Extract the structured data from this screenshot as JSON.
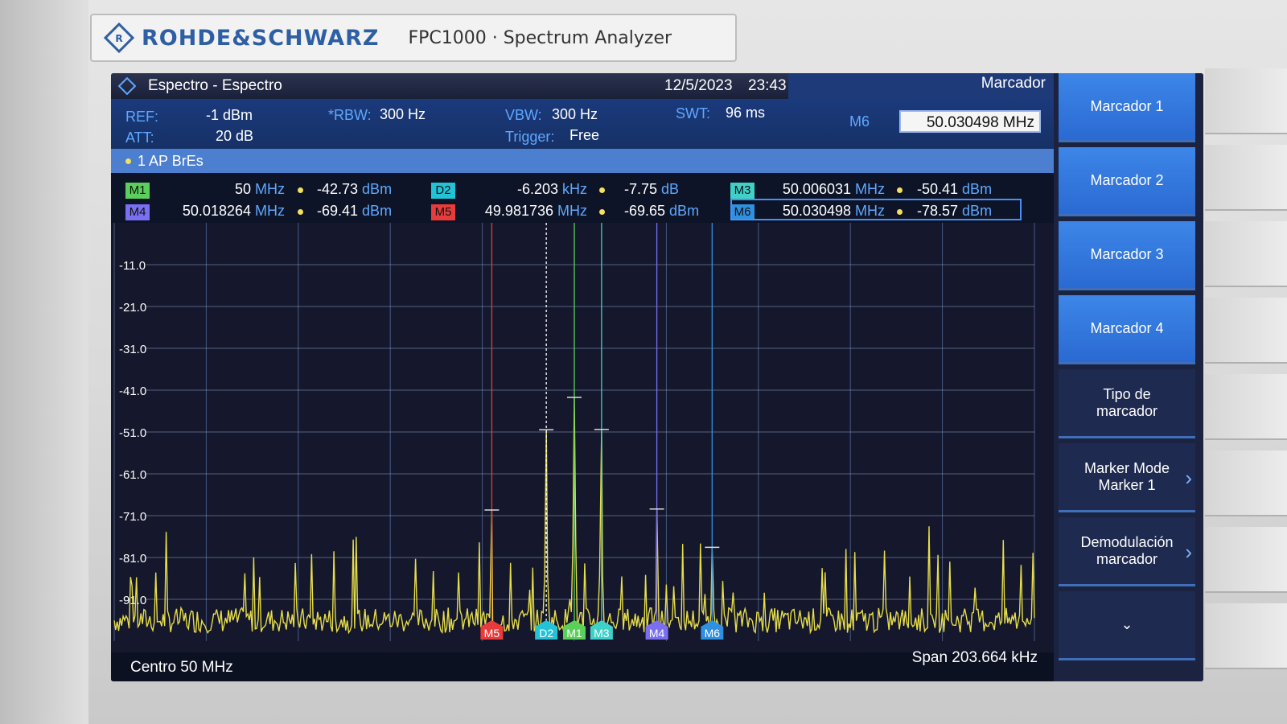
{
  "brand": {
    "name": "ROHDE&SCHWARZ",
    "model": "FPC1000 · Spectrum Analyzer"
  },
  "titlebar": {
    "title": "Espectro - Espectro",
    "date": "12/5/2023",
    "time": "23:43",
    "panel": "Marcador"
  },
  "params": {
    "ref_label": "REF:",
    "ref_value": "-1 dBm",
    "att_label": "ATT:",
    "att_value": "20 dB",
    "rbw_label": "*RBW:",
    "rbw_value": "300 Hz",
    "vbw_label": "VBW:",
    "vbw_value": "300 Hz",
    "trigger_label": "Trigger:",
    "trigger_value": "Free",
    "swt_label": "SWT:",
    "swt_value": "96 ms",
    "marker_edit_label": "M6",
    "marker_edit_value": "50.030498 MHz"
  },
  "trace": {
    "label": "1 AP  BrEs"
  },
  "markers": [
    {
      "tag": "M1",
      "freq": "50",
      "freq_unit": "MHz",
      "level": "-42.73",
      "level_unit": "dBm",
      "color": "#5ad05a"
    },
    {
      "tag": "D2",
      "freq": "-6.203",
      "freq_unit": "kHz",
      "level": "-7.75",
      "level_unit": "dB",
      "color": "#22c3d6"
    },
    {
      "tag": "M3",
      "freq": "50.006031",
      "freq_unit": "MHz",
      "level": "-50.41",
      "level_unit": "dBm",
      "color": "#3fd0c8"
    },
    {
      "tag": "M4",
      "freq": "50.018264",
      "freq_unit": "MHz",
      "level": "-69.41",
      "level_unit": "dBm",
      "color": "#7a6ff0"
    },
    {
      "tag": "M5",
      "freq": "49.981736",
      "freq_unit": "MHz",
      "level": "-69.65",
      "level_unit": "dBm",
      "color": "#e83b3b"
    },
    {
      "tag": "M6",
      "freq": "50.030498",
      "freq_unit": "MHz",
      "level": "-78.57",
      "level_unit": "dBm",
      "color": "#2f8fe0"
    }
  ],
  "chart": {
    "y_ticks": [
      "-11.0",
      "-21.0",
      "-31.0",
      "-41.0",
      "-51.0",
      "-61.0",
      "-71.0",
      "-81.0",
      "-91.0"
    ],
    "center": "Centro 50 MHz",
    "span": "Span 203.664 kHz",
    "trace_color": "#e6dd4a"
  },
  "chart_data": {
    "type": "line",
    "x_unit": "MHz",
    "y_unit": "dBm",
    "xlim": [
      49.898168,
      50.101832
    ],
    "ylim": [
      -101,
      -1
    ],
    "peaks": [
      {
        "marker": "M5",
        "x": 49.981736,
        "y": -69.65,
        "color": "#e83b3b"
      },
      {
        "marker": "D2",
        "x": 49.993797,
        "y": -50.48,
        "color": "#22c3d6"
      },
      {
        "marker": "M1",
        "x": 50.0,
        "y": -42.73,
        "color": "#5ad05a"
      },
      {
        "marker": "M3",
        "x": 50.006031,
        "y": -50.41,
        "color": "#3fd0c8"
      },
      {
        "marker": "M4",
        "x": 50.018264,
        "y": -69.41,
        "color": "#7a6ff0"
      },
      {
        "marker": "M6",
        "x": 50.030498,
        "y": -78.57,
        "color": "#2f8fe0"
      }
    ],
    "noise_floor": -97,
    "grid": true
  },
  "softkeys": [
    {
      "label": "Marcador 1",
      "style": "blue"
    },
    {
      "label": "Marcador 2",
      "style": "blue"
    },
    {
      "label": "Marcador 3",
      "style": "blue"
    },
    {
      "label": "Marcador 4",
      "style": "blue"
    },
    {
      "label": "Tipo de marcador",
      "style": "dark"
    },
    {
      "label": "Marker Mode Marker 1",
      "style": "dark",
      "arrow": "›"
    },
    {
      "label": "Demodulación marcador",
      "style": "dark",
      "arrow": "›"
    },
    {
      "label": "⌄",
      "style": "dark"
    }
  ]
}
